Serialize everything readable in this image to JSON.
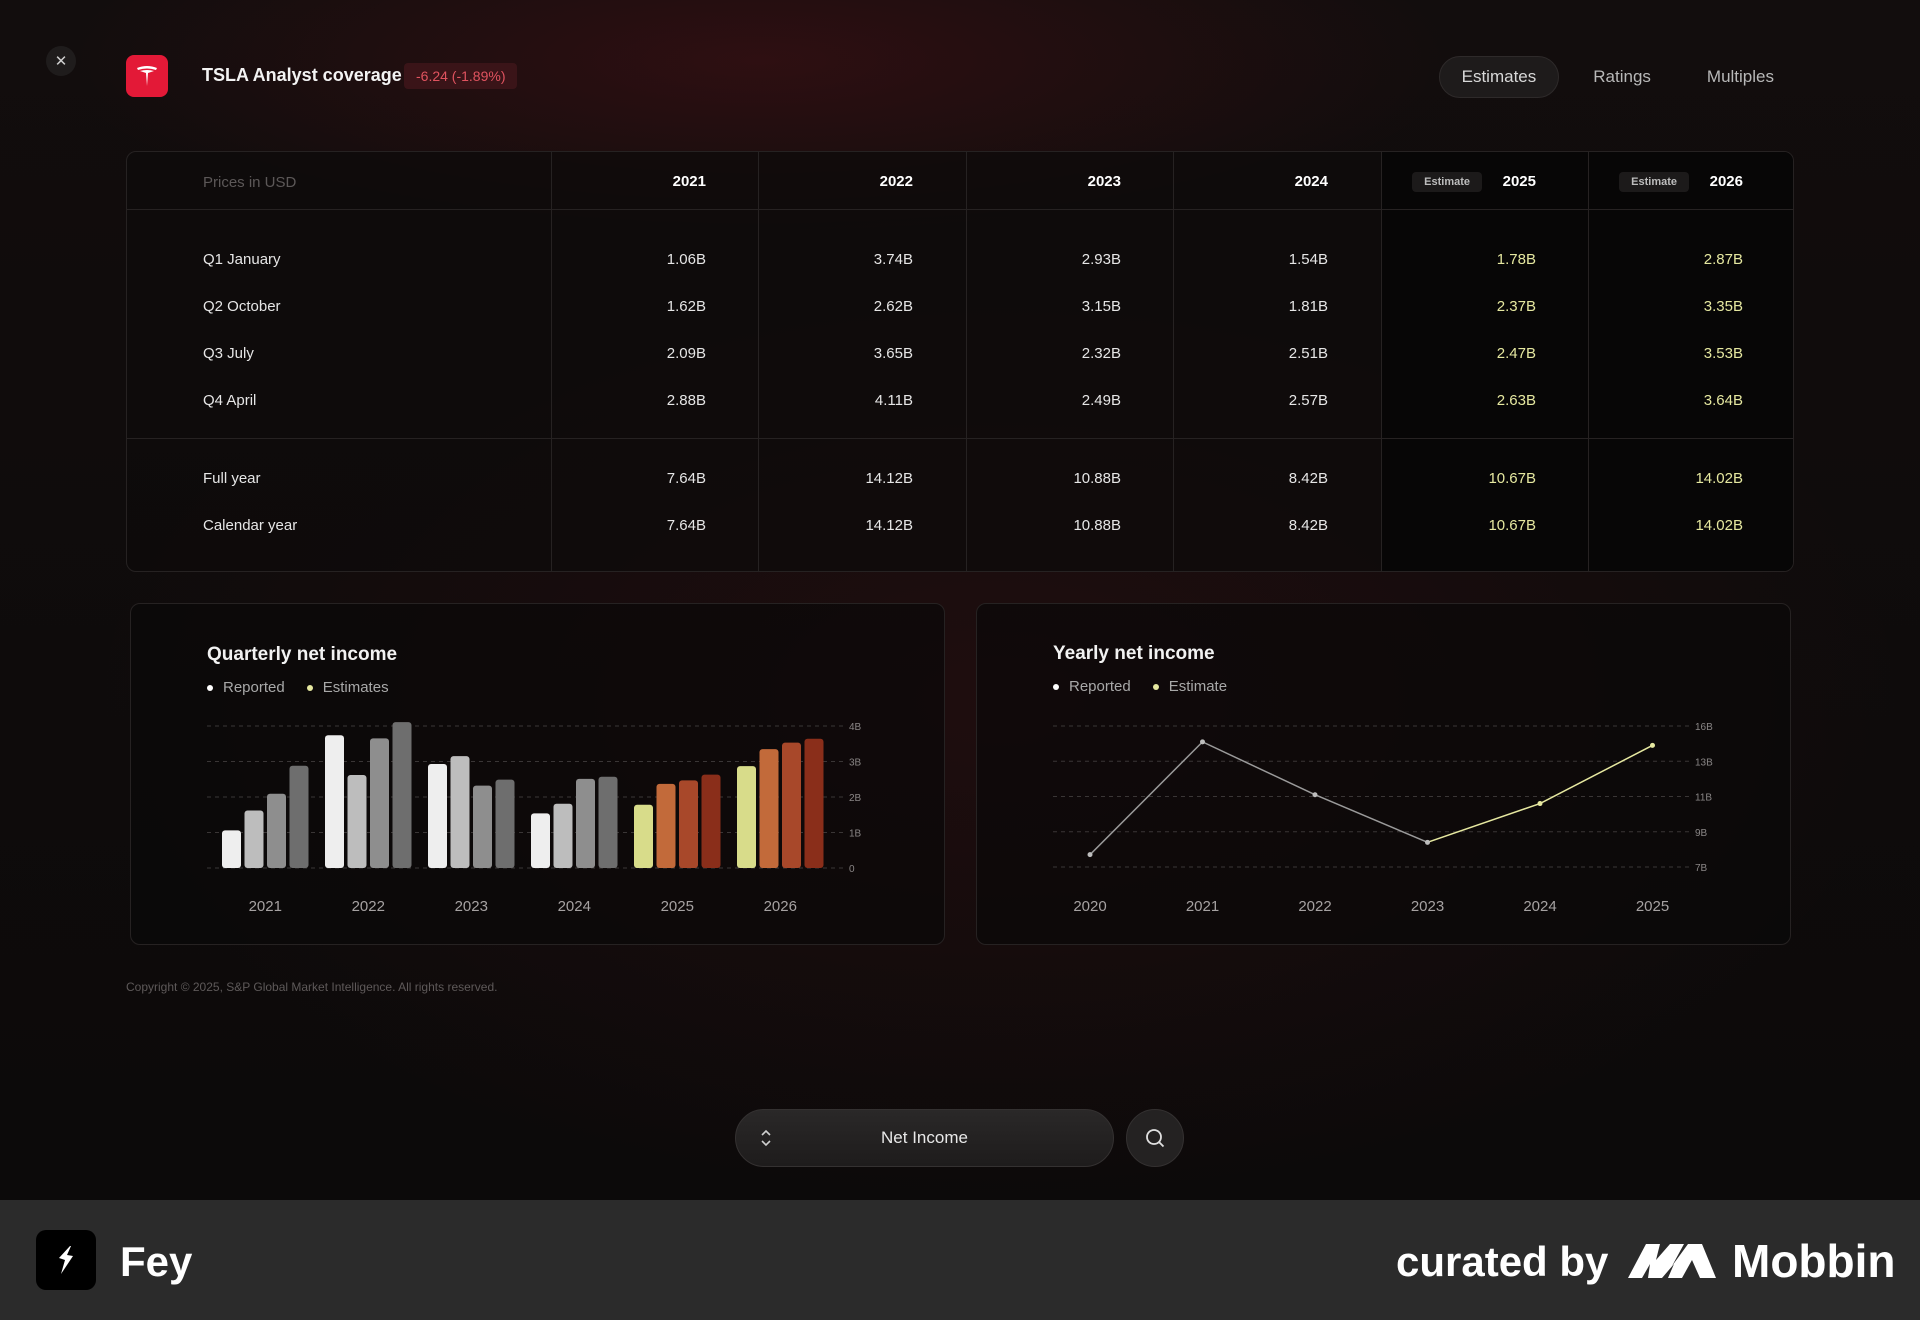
{
  "header": {
    "title": "TSLA Analyst coverage",
    "change": "-6.24 (-1.89%)",
    "close_icon": "close-icon",
    "logo_icon": "tesla-logo-icon",
    "tabs": [
      {
        "label": "Estimates",
        "active": true
      },
      {
        "label": "Ratings",
        "active": false
      },
      {
        "label": "Multiples",
        "active": false
      }
    ]
  },
  "table": {
    "units_label": "Prices in USD",
    "estimate_badge": "Estimate",
    "years": [
      "2021",
      "2022",
      "2023",
      "2024",
      "2025",
      "2026"
    ],
    "estimate_years": [
      "2025",
      "2026"
    ],
    "quarter_rows": [
      {
        "label": "Q1 January",
        "values": [
          "1.06B",
          "3.74B",
          "2.93B",
          "1.54B",
          "1.78B",
          "2.87B"
        ]
      },
      {
        "label": "Q2 October",
        "values": [
          "1.62B",
          "2.62B",
          "3.15B",
          "1.81B",
          "2.37B",
          "3.35B"
        ]
      },
      {
        "label": "Q3 July",
        "values": [
          "2.09B",
          "3.65B",
          "2.32B",
          "2.51B",
          "2.47B",
          "3.53B"
        ]
      },
      {
        "label": "Q4 April",
        "values": [
          "2.88B",
          "4.11B",
          "2.49B",
          "2.57B",
          "2.63B",
          "3.64B"
        ]
      }
    ],
    "total_rows": [
      {
        "label": "Full year",
        "values": [
          "7.64B",
          "14.12B",
          "10.88B",
          "8.42B",
          "10.67B",
          "14.02B"
        ]
      },
      {
        "label": "Calendar year",
        "values": [
          "7.64B",
          "14.12B",
          "10.88B",
          "8.42B",
          "10.67B",
          "14.02B"
        ]
      }
    ],
    "colors": {
      "estimate_text": "#e6e8a0"
    }
  },
  "chart_data": [
    {
      "type": "bar",
      "title": "Quarterly net income",
      "legend": [
        {
          "name": "Reported",
          "color": "#ffffff"
        },
        {
          "name": "Estimates",
          "color": "#e6e8a0"
        }
      ],
      "categories": [
        "2021",
        "2022",
        "2023",
        "2024",
        "2025",
        "2026"
      ],
      "series": [
        {
          "name": "Q1",
          "values": [
            1.06,
            3.74,
            2.93,
            1.54,
            1.78,
            2.87
          ]
        },
        {
          "name": "Q2",
          "values": [
            1.62,
            2.62,
            3.15,
            1.81,
            2.37,
            3.35
          ]
        },
        {
          "name": "Q3",
          "values": [
            2.09,
            3.65,
            2.32,
            2.51,
            2.47,
            3.53
          ]
        },
        {
          "name": "Q4",
          "values": [
            2.88,
            4.11,
            2.49,
            2.57,
            2.63,
            3.64
          ]
        }
      ],
      "estimate_categories": [
        "2025",
        "2026"
      ],
      "y_ticks": [
        "0",
        "1B",
        "2B",
        "3B",
        "4B"
      ],
      "ylim": [
        0,
        4
      ],
      "grid": true,
      "legend_placement": "top-left",
      "colors": {
        "reported": [
          "#eeeeee",
          "#bdbdbd",
          "#8e8e8e",
          "#6e6e6e"
        ],
        "estimate": [
          "#d8dc8a",
          "#c26a3a",
          "#a8482a",
          "#8a2e1a"
        ]
      }
    },
    {
      "type": "line",
      "title": "Yearly net income",
      "legend": [
        {
          "name": "Reported",
          "color": "#ffffff"
        },
        {
          "name": "Estimate",
          "color": "#e6e8a0"
        }
      ],
      "x": [
        "2020",
        "2021",
        "2022",
        "2023",
        "2024",
        "2025"
      ],
      "values": [
        7.7,
        14.1,
        11.1,
        8.4,
        10.6,
        13.9
      ],
      "estimate_from_index": 3,
      "y_ticks": [
        "7B",
        "9B",
        "11B",
        "13B",
        "16B"
      ],
      "ylim": [
        7,
        15
      ],
      "grid": true,
      "legend_placement": "top-left",
      "colors": {
        "reported": "#9a9a9a",
        "estimate": "#e6e8a0"
      }
    }
  ],
  "copyright": "Copyright © 2025, S&P Global Market Intelligence. All rights reserved.",
  "metric_selector": {
    "label": "Net Income",
    "icon": "chevron-up-down-icon"
  },
  "search": {
    "icon": "search-icon"
  },
  "footer": {
    "app_name": "Fey",
    "curated_by": "curated by",
    "brand": "Mobbin"
  }
}
